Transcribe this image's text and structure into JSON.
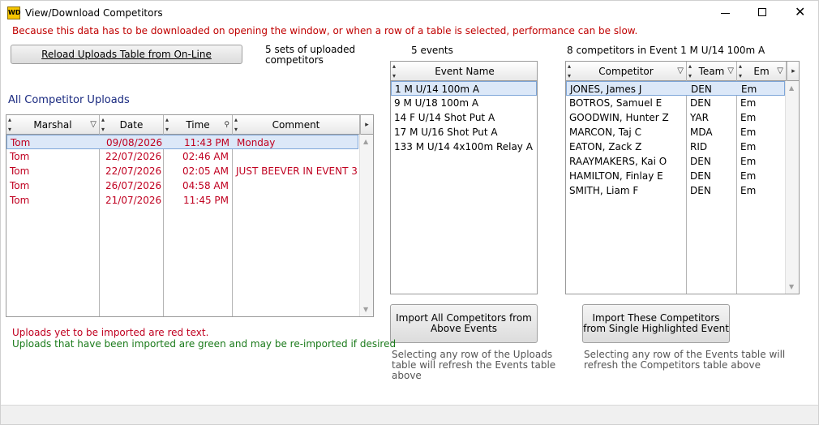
{
  "window": {
    "title": "View/Download Competitors",
    "icon_text": "WD",
    "close_glyph": "✕"
  },
  "warning": "Because this data has to be downloaded on opening the window, or when a row of a table is selected, performance can be slow.",
  "reload_button": {
    "label": "Reload Uploads Table from On-Line"
  },
  "uploads_count": "5 sets of uploaded competitors",
  "events_count": "5 events",
  "competitors_count": "8  competitors in Event 1 M U/14 100m A",
  "uploads_title": "All Competitor Uploads",
  "uploads_table": {
    "headers": [
      "Marshal",
      "Date",
      "Time",
      "Comment"
    ],
    "rows": [
      {
        "marshal": "Tom",
        "date": "09/08/2026",
        "time": "11:43 PM",
        "comment": "Monday"
      },
      {
        "marshal": "Tom",
        "date": "22/07/2026",
        "time": "02:46 AM",
        "comment": ""
      },
      {
        "marshal": "Tom",
        "date": "22/07/2026",
        "time": "02:05 AM",
        "comment": "JUST BEEVER IN EVENT 3"
      },
      {
        "marshal": "Tom",
        "date": "26/07/2026",
        "time": "04:58 AM",
        "comment": ""
      },
      {
        "marshal": "Tom",
        "date": "21/07/2026",
        "time": "11:45 PM",
        "comment": ""
      }
    ]
  },
  "events_table": {
    "header": "Event Name",
    "rows": [
      "1 M U/14 100m A",
      "9 M U/18 100m A",
      "14 F U/14 Shot Put A",
      "17 M U/16 Shot Put A",
      "133 M U/14 4x100m Relay A"
    ]
  },
  "competitors_table": {
    "headers": [
      "Competitor",
      "Team",
      "Em"
    ],
    "rows": [
      {
        "name": "JONES, James J",
        "team": "DEN",
        "em": "Em"
      },
      {
        "name": "BOTROS, Samuel E",
        "team": "DEN",
        "em": "Em"
      },
      {
        "name": "GOODWIN, Hunter Z",
        "team": "YAR",
        "em": "Em"
      },
      {
        "name": "MARCON, Taj C",
        "team": "MDA",
        "em": "Em"
      },
      {
        "name": "EATON, Zack Z",
        "team": "RID",
        "em": "Em"
      },
      {
        "name": "RAAYMAKERS, Kai O",
        "team": "DEN",
        "em": "Em"
      },
      {
        "name": "HAMILTON, Finlay E",
        "team": "DEN",
        "em": "Em"
      },
      {
        "name": "SMITH, Liam F",
        "team": "DEN",
        "em": "Em"
      }
    ]
  },
  "import_all_button": {
    "label_line1": "Import All Competitors from",
    "label_line2": "Above Events"
  },
  "import_these_button": {
    "label_line1": "Import These Competitors",
    "label_line2": "from Single Highlighted Event"
  },
  "legend": {
    "red": "Uploads yet to be imported are red text.",
    "green": "Uploads that have been imported are green and may be re-imported if desired"
  },
  "hint_uploads": "Selecting any row of the Uploads table will refresh the Events table above",
  "hint_events": "Selecting any row of the Events table will refresh the Competitors table above",
  "colors": {
    "pending": "#c00020",
    "imported": "#1a7a1a",
    "warning": "#c00000",
    "selection": "#dce8f8"
  }
}
